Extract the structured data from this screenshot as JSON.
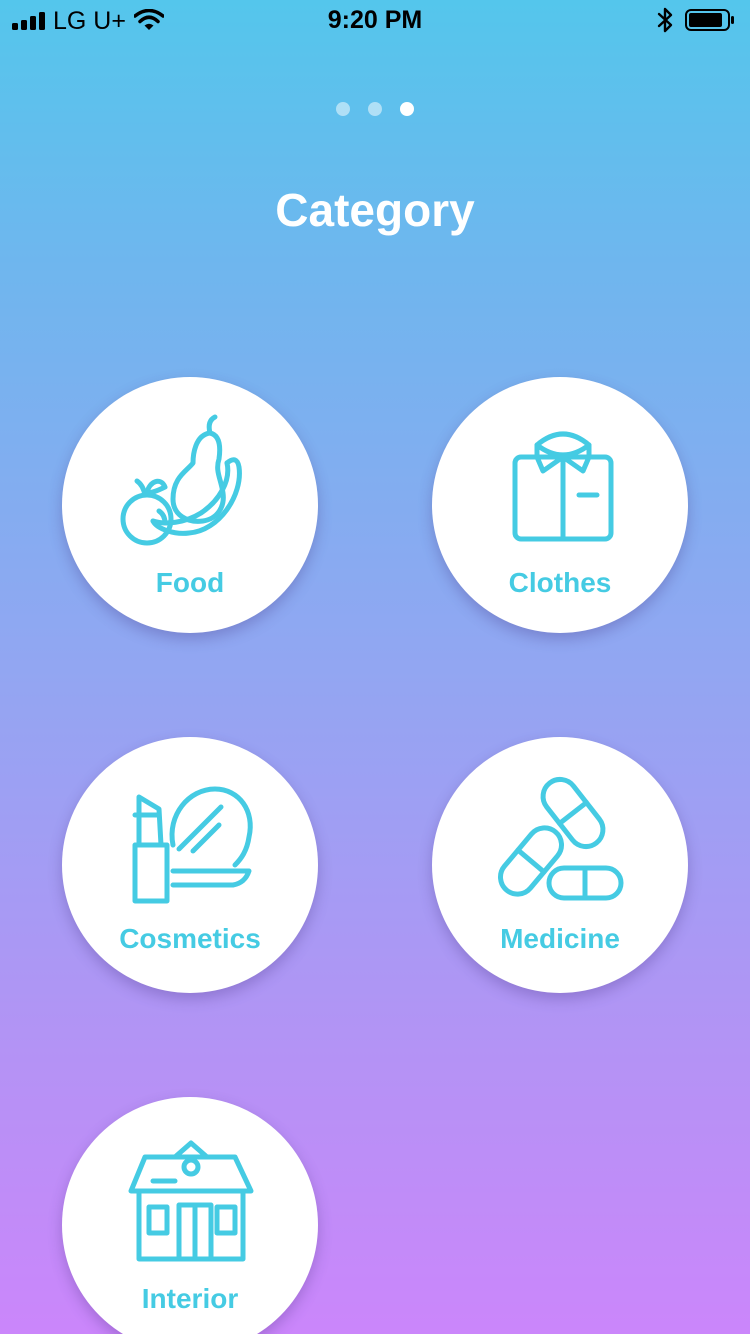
{
  "status_bar": {
    "carrier": "LG U+",
    "time": "9:20 PM"
  },
  "pager": {
    "count": 3,
    "active_index": 2
  },
  "title": "Category",
  "colors": {
    "accent": "#45cbe3",
    "gradient_top": "#54c6ec",
    "gradient_bottom": "#cb86fb",
    "card_bg": "#ffffff"
  },
  "categories": [
    {
      "label": "Food",
      "icon": "fruit-icon"
    },
    {
      "label": "Clothes",
      "icon": "shirt-icon"
    },
    {
      "label": "Cosmetics",
      "icon": "lipstick-mirror-icon"
    },
    {
      "label": "Medicine",
      "icon": "pills-icon"
    },
    {
      "label": "Interior",
      "icon": "house-icon"
    }
  ]
}
